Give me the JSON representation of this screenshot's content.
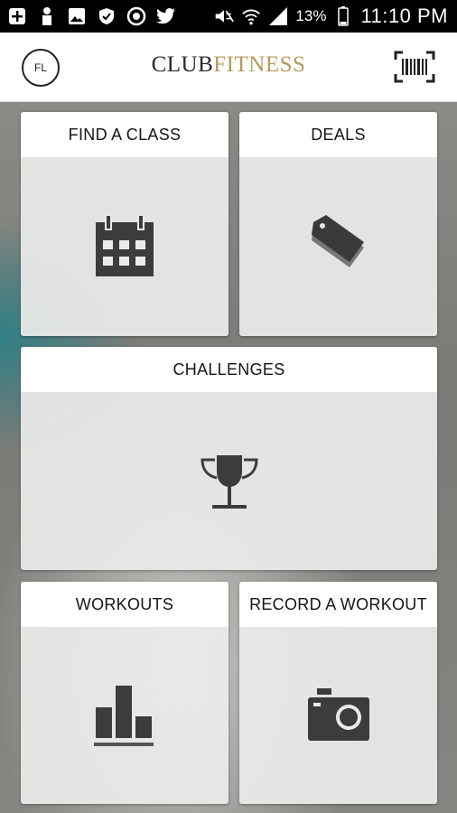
{
  "status_bar": {
    "battery_percent": "13%",
    "time": "11:10 PM",
    "icons": [
      "plus-box-icon",
      "person-icon",
      "image-icon",
      "shield-icon",
      "sync-icon",
      "twitter-icon",
      "mute-icon",
      "wifi-icon",
      "signal-icon",
      "battery-icon"
    ]
  },
  "header": {
    "avatar_initials": "FL",
    "logo_part1": "CLUB",
    "logo_part2": "FITNESS",
    "logo_accent_color": "#b59a5b",
    "barcode_icon": "barcode-icon"
  },
  "tiles": [
    {
      "label": "FIND A CLASS",
      "icon": "calendar-icon"
    },
    {
      "label": "DEALS",
      "icon": "tag-icon"
    },
    {
      "label": "CHALLENGES",
      "icon": "trophy-icon"
    },
    {
      "label": "WORKOUTS",
      "icon": "bar-chart-icon"
    },
    {
      "label": "RECORD A WORKOUT",
      "icon": "camera-icon"
    }
  ]
}
